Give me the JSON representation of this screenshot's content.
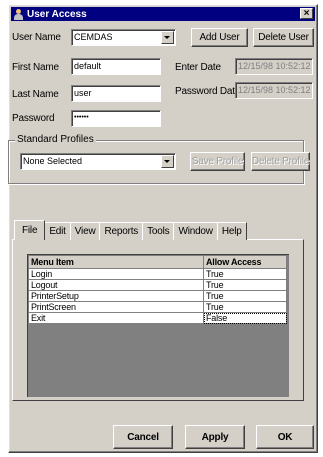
{
  "window": {
    "title": "User Access",
    "close_label": "×"
  },
  "form": {
    "user_name_label": "User Name",
    "user_name_value": "CEMDAS",
    "add_user_label": "Add User",
    "delete_user_label": "Delete User",
    "first_name_label": "First Name",
    "first_name_value": "default",
    "enter_date_label": "Enter Date",
    "enter_date_value": "12/15/98 10:52:12",
    "last_name_label": "Last Name",
    "last_name_value": "user",
    "password_date_label": "Password Date",
    "password_date_value": "12/15/98 10:52:12",
    "password_label": "Password",
    "password_value": "••••••"
  },
  "profiles": {
    "group_title": "Standard Profiles",
    "selected": "None Selected",
    "save_label": "Save Profile",
    "delete_label": "Delete Profile"
  },
  "tabs": [
    {
      "label": "File"
    },
    {
      "label": "Edit"
    },
    {
      "label": "View"
    },
    {
      "label": "Reports"
    },
    {
      "label": "Tools"
    },
    {
      "label": "Window"
    },
    {
      "label": "Help"
    }
  ],
  "grid": {
    "headers": [
      "Menu Item",
      "Allow Access"
    ],
    "rows": [
      {
        "item": "Login",
        "access": "True"
      },
      {
        "item": "Logout",
        "access": "True"
      },
      {
        "item": "PrinterSetup",
        "access": "True"
      },
      {
        "item": "PrintScreen",
        "access": "True"
      },
      {
        "item": "Exit",
        "access": "False"
      }
    ]
  },
  "footer": {
    "cancel_label": "Cancel",
    "apply_label": "Apply",
    "ok_label": "OK"
  },
  "colors": {
    "titlebar": "#000080",
    "face": "#d4d0c8",
    "grid_empty": "#808080"
  }
}
